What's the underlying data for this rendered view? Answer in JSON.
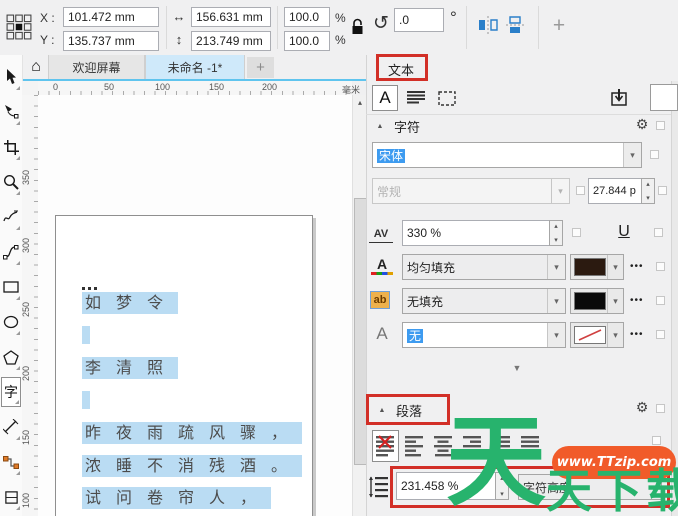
{
  "property_bar": {
    "x_label": "X :",
    "x_value": "101.472 mm",
    "y_label": "Y :",
    "y_value": "135.737 mm",
    "width_value": "156.631 mm",
    "height_value": "213.749 mm",
    "scale_h": "100.0",
    "scale_v": "100.0",
    "percent": "%",
    "rotation_value": ".0",
    "degree": "°"
  },
  "tabs": {
    "welcome": "欢迎屏幕",
    "document": "未命名 -1*"
  },
  "rulers": {
    "unit": "毫米",
    "h_ticks": [
      "0",
      "50",
      "100",
      "150",
      "200"
    ],
    "v_ticks": [
      "350",
      "300",
      "250",
      "200",
      "150",
      "100"
    ]
  },
  "canvas": {
    "lines": [
      "如梦令",
      "李清照",
      "昨夜雨疏风骤，",
      "浓睡不消残酒。",
      "试问卷帘人，"
    ]
  },
  "panel": {
    "title": "文本",
    "character": {
      "header": "字符",
      "font_name": "宋体",
      "font_style": "常规",
      "font_size": "27.844 p",
      "char_spacing": "330 %",
      "fill_label": "均匀填充",
      "background_label": "无填充",
      "outline_label": "无"
    },
    "paragraph": {
      "header": "段落",
      "line_spacing": "231.458 %",
      "line_spacing_unit": "字符高度"
    }
  },
  "watermark": {
    "big_char": "天",
    "text": "天下载",
    "url": "www.TTzip.com"
  },
  "icons": {
    "home": "⌂",
    "plus": "+",
    "rotate": "↺",
    "width": "↔",
    "height": "↕",
    "gear": "⚙",
    "collapse": "▲",
    "expand": "▼",
    "dropdown": "▾",
    "spin_up": "▴",
    "spin_down": "▾",
    "scroll_up": "▴",
    "ellipsis": "•••",
    "underline": "U",
    "char_tab": "A",
    "av": "AV",
    "ab": "ab",
    "outline_a": "A",
    "text_tool": "字"
  },
  "colors": {
    "accent_red": "#d22f27",
    "selection_blue": "#3d9bf0",
    "highlight_blue": "#badcf3",
    "tab_active": "#cfe9fa",
    "watermark_green": "#27b36d",
    "watermark_orange": "#f15b2a",
    "mirror_blue": "#2a7fc9"
  }
}
